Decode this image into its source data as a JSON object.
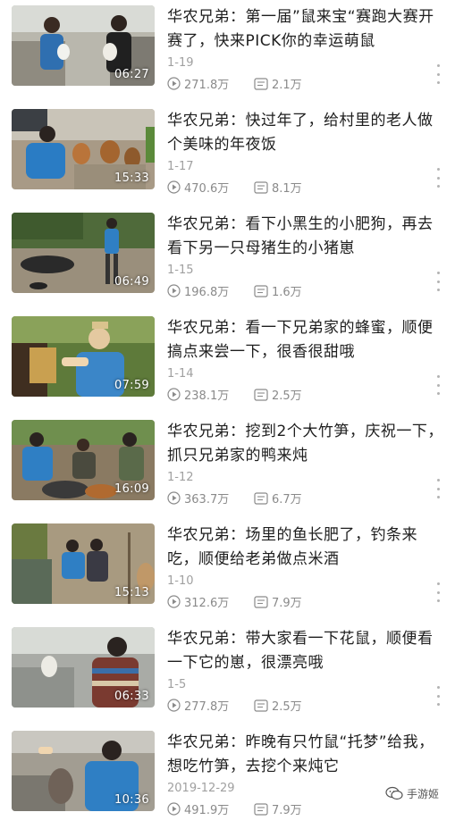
{
  "videos": [
    {
      "title": "华农兄弟：第一届”鼠来宝“赛跑大赛开赛了，快来PICK你的幸运萌鼠",
      "date": "1-19",
      "duration": "06:27",
      "plays": "271.8万",
      "comments": "2.1万"
    },
    {
      "title": "华农兄弟：快过年了，给村里的老人做个美味的年夜饭",
      "date": "1-17",
      "duration": "15:33",
      "plays": "470.6万",
      "comments": "8.1万"
    },
    {
      "title": "华农兄弟：看下小黑生的小肥狗，再去看下另一只母猪生的小猪崽",
      "date": "1-15",
      "duration": "06:49",
      "plays": "196.8万",
      "comments": "1.6万"
    },
    {
      "title": "华农兄弟：看一下兄弟家的蜂蜜，顺便搞点来尝一下，很香很甜哦",
      "date": "1-14",
      "duration": "07:59",
      "plays": "238.1万",
      "comments": "2.5万"
    },
    {
      "title": "华农兄弟：挖到2个大竹笋，庆祝一下，抓只兄弟家的鸭来炖",
      "date": "1-12",
      "duration": "16:09",
      "plays": "363.7万",
      "comments": "6.7万"
    },
    {
      "title": "华农兄弟：场里的鱼长肥了，钓条来吃，顺便给老弟做点米酒",
      "date": "1-10",
      "duration": "15:13",
      "plays": "312.6万",
      "comments": "7.9万"
    },
    {
      "title": "华农兄弟：带大家看一下花鼠，顺便看一下它的崽，很漂亮哦",
      "date": "1-5",
      "duration": "06:33",
      "plays": "277.8万",
      "comments": "2.5万"
    },
    {
      "title": "华农兄弟：昨晚有只竹鼠“托梦”给我，想吃竹笋，去挖个来炖它",
      "date": "2019-12-29",
      "duration": "10:36",
      "plays": "491.9万",
      "comments": "7.9万"
    }
  ],
  "watermark": {
    "text": "手游姬",
    "icon": "wechat-icon"
  },
  "colors": {
    "meta": "#8a8a8a",
    "date": "#a0a0a0",
    "title": "#1e1e1e"
  }
}
